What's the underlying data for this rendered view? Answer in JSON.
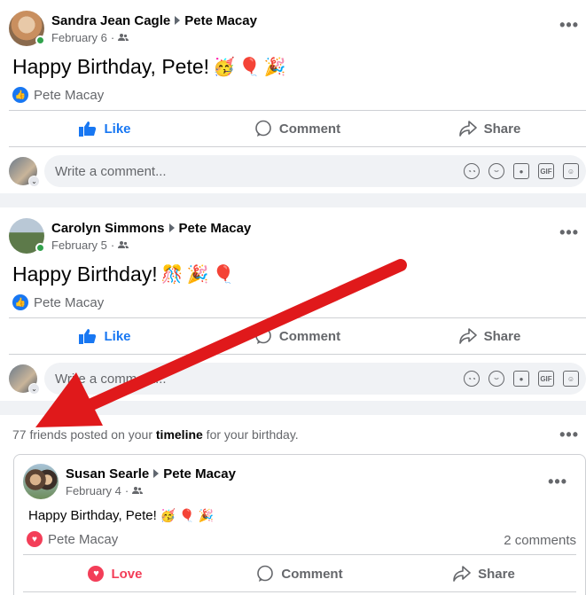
{
  "posts": [
    {
      "author": "Sandra Jean Cagle",
      "target": "Pete Macay",
      "date": "February 6",
      "audience_icon": "friends-icon",
      "text": "Happy Birthday, Pete!",
      "emojis": [
        "🥳",
        "🎈",
        "🎉"
      ],
      "reaction_by": "Pete Macay",
      "reaction_type": "like"
    },
    {
      "author": "Carolyn Simmons",
      "target": "Pete Macay",
      "date": "February 5",
      "audience_icon": "friends-icon",
      "text": "Happy Birthday!",
      "emojis": [
        "🎊",
        "🎉",
        "🎈"
      ],
      "reaction_by": "Pete Macay",
      "reaction_type": "like"
    }
  ],
  "actions": {
    "like": "Like",
    "comment": "Comment",
    "share": "Share",
    "love": "Love"
  },
  "comment_box": {
    "placeholder": "Write a comment...",
    "icons": [
      "avatar-sticker-icon",
      "emoji-icon",
      "camera-icon",
      "gif-icon",
      "sticker-icon"
    ]
  },
  "summary": {
    "prefix": "77 friends posted on your ",
    "link": "timeline",
    "suffix": " for your birthday."
  },
  "nested_post": {
    "author": "Susan Searle",
    "target": "Pete Macay",
    "date": "February 4",
    "text": "Happy Birthday, Pete!",
    "emojis": [
      "🥳",
      "🎈",
      "🎉"
    ],
    "reaction_by": "Pete Macay",
    "reaction_type": "love",
    "comments_count": "2 comments"
  },
  "colors": {
    "accent": "#1877f2",
    "love": "#f33e58",
    "online": "#31a24c",
    "annotation_arrow": "#e0191b"
  }
}
